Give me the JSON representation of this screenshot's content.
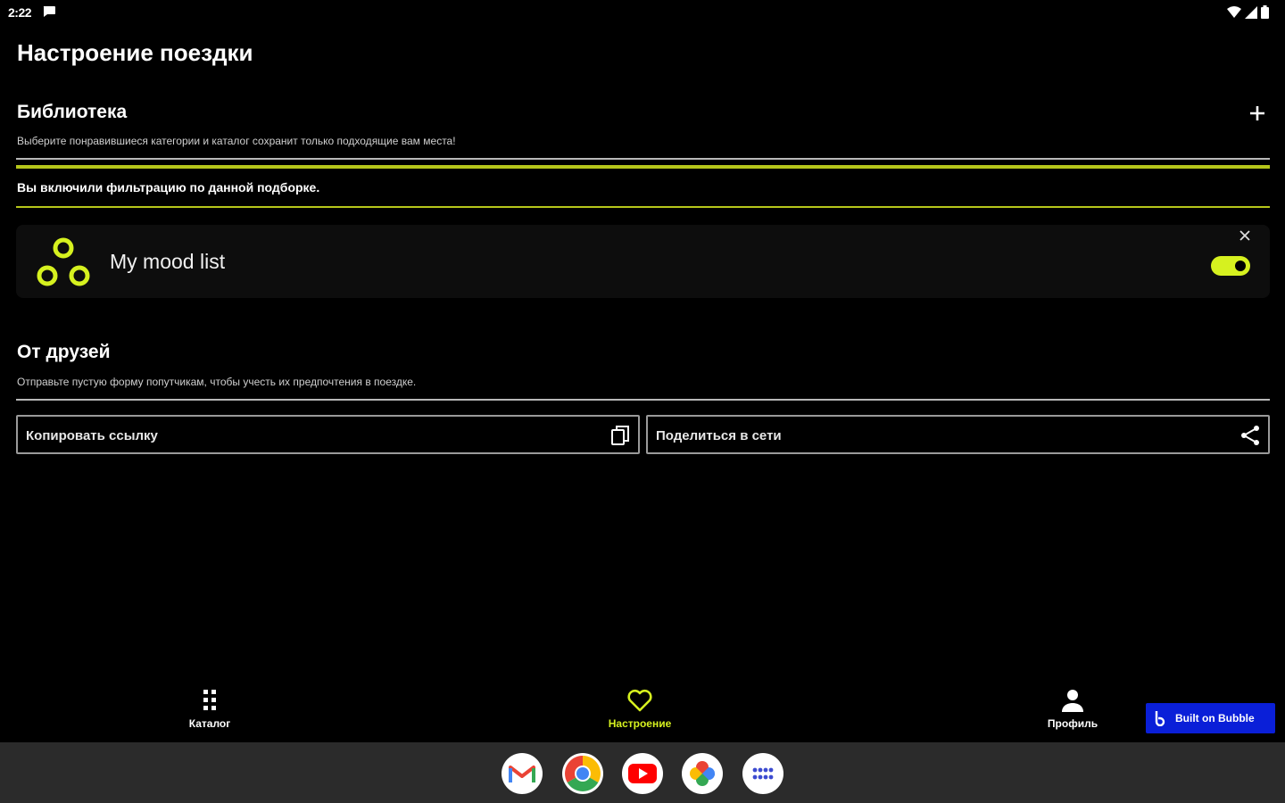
{
  "status_bar": {
    "time": "2:22"
  },
  "page_title": "Настроение поездки",
  "library": {
    "title": "Библиотека",
    "subtitle": "Выберите понравившиеся категории и каталог сохранит только подходящие вам места!"
  },
  "filter_note": "Вы включили фильтрацию по данной подборке.",
  "mood_card": {
    "title": "My mood list",
    "toggle_on": true
  },
  "friends": {
    "title": "От друзей",
    "subtitle": "Отправьте пустую форму попутчикам, чтобы учесть их предпочтения в поездке."
  },
  "actions": {
    "copy_link": "Копировать ссылку",
    "share": "Поделиться в сети"
  },
  "bottom_nav": [
    {
      "label": "Каталог",
      "icon": "grid-dots-icon",
      "active": false
    },
    {
      "label": "Настроение",
      "icon": "heart-icon",
      "active": true
    },
    {
      "label": "Профиль",
      "icon": "person-icon",
      "active": false
    }
  ],
  "bubble_badge": "Built on Bubble",
  "dock": [
    "gmail-icon",
    "chrome-icon",
    "youtube-icon",
    "photos-icon",
    "apps-icon"
  ],
  "colors": {
    "accent": "#d6f11f",
    "background": "#000000",
    "dock": "#2b2b2b",
    "bubble": "#0a1fd8"
  }
}
